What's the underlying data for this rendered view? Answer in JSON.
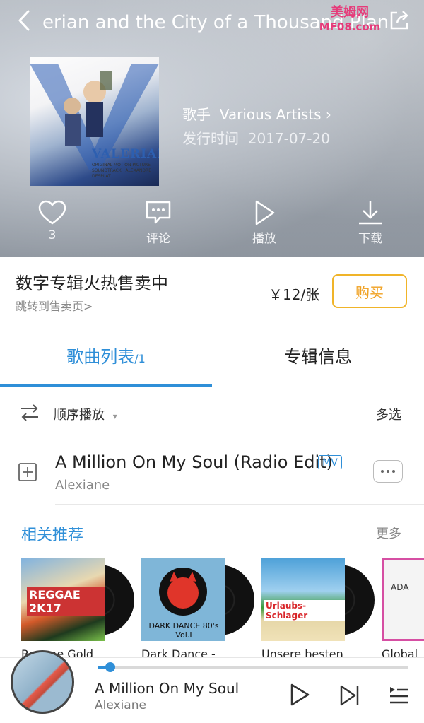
{
  "header": {
    "title": "erian and the City of a Thousand Plan",
    "watermark": [
      "美姆网",
      "MF08.com"
    ],
    "cover": {
      "title_text": "VALERIAN",
      "subtitle_text": "ORIGINAL MOTION PICTURE SOUNDTRACK · ALEXANDRE DESPLAT"
    },
    "artist_label": "歌手",
    "artist_value": "Various Artists",
    "release_label": "发行时间",
    "release_value": "2017-07-20",
    "actions": [
      {
        "label": "3",
        "icon": "heart-icon"
      },
      {
        "label": "评论",
        "icon": "comment-icon"
      },
      {
        "label": "播放",
        "icon": "play-icon"
      },
      {
        "label": "下载",
        "icon": "download-icon"
      }
    ]
  },
  "digital": {
    "title": "数字专辑火热售卖中",
    "link": "跳转到售卖页>",
    "price": "￥12/张",
    "buy_label": "购买"
  },
  "tabs": {
    "songs_label": "歌曲列表",
    "songs_count": "/1",
    "info_label": "专辑信息"
  },
  "controls": {
    "order_label": "顺序播放",
    "multi_label": "多选"
  },
  "song": {
    "title": "A Million On My Soul (Radio Edit)",
    "badge": "MV",
    "artist": "Alexiane"
  },
  "recommend": {
    "title": "相关推荐",
    "more": "更多",
    "items": [
      {
        "caption": "Reggae Gold",
        "art_text": "REGGAE 2K17"
      },
      {
        "caption": "Dark Dance -",
        "art_text": "DARK DANCE 80's Vol.I"
      },
      {
        "caption": "Unsere besten",
        "art_text": "Urlaubs-Schlager"
      },
      {
        "caption": "Global",
        "art_text": "ADA"
      }
    ]
  },
  "player": {
    "title": "A Million On My Soul",
    "artist": "Alexiane",
    "progress": 0.04
  },
  "colors": {
    "accent": "#2f8fd8",
    "buy": "#f0b429"
  }
}
